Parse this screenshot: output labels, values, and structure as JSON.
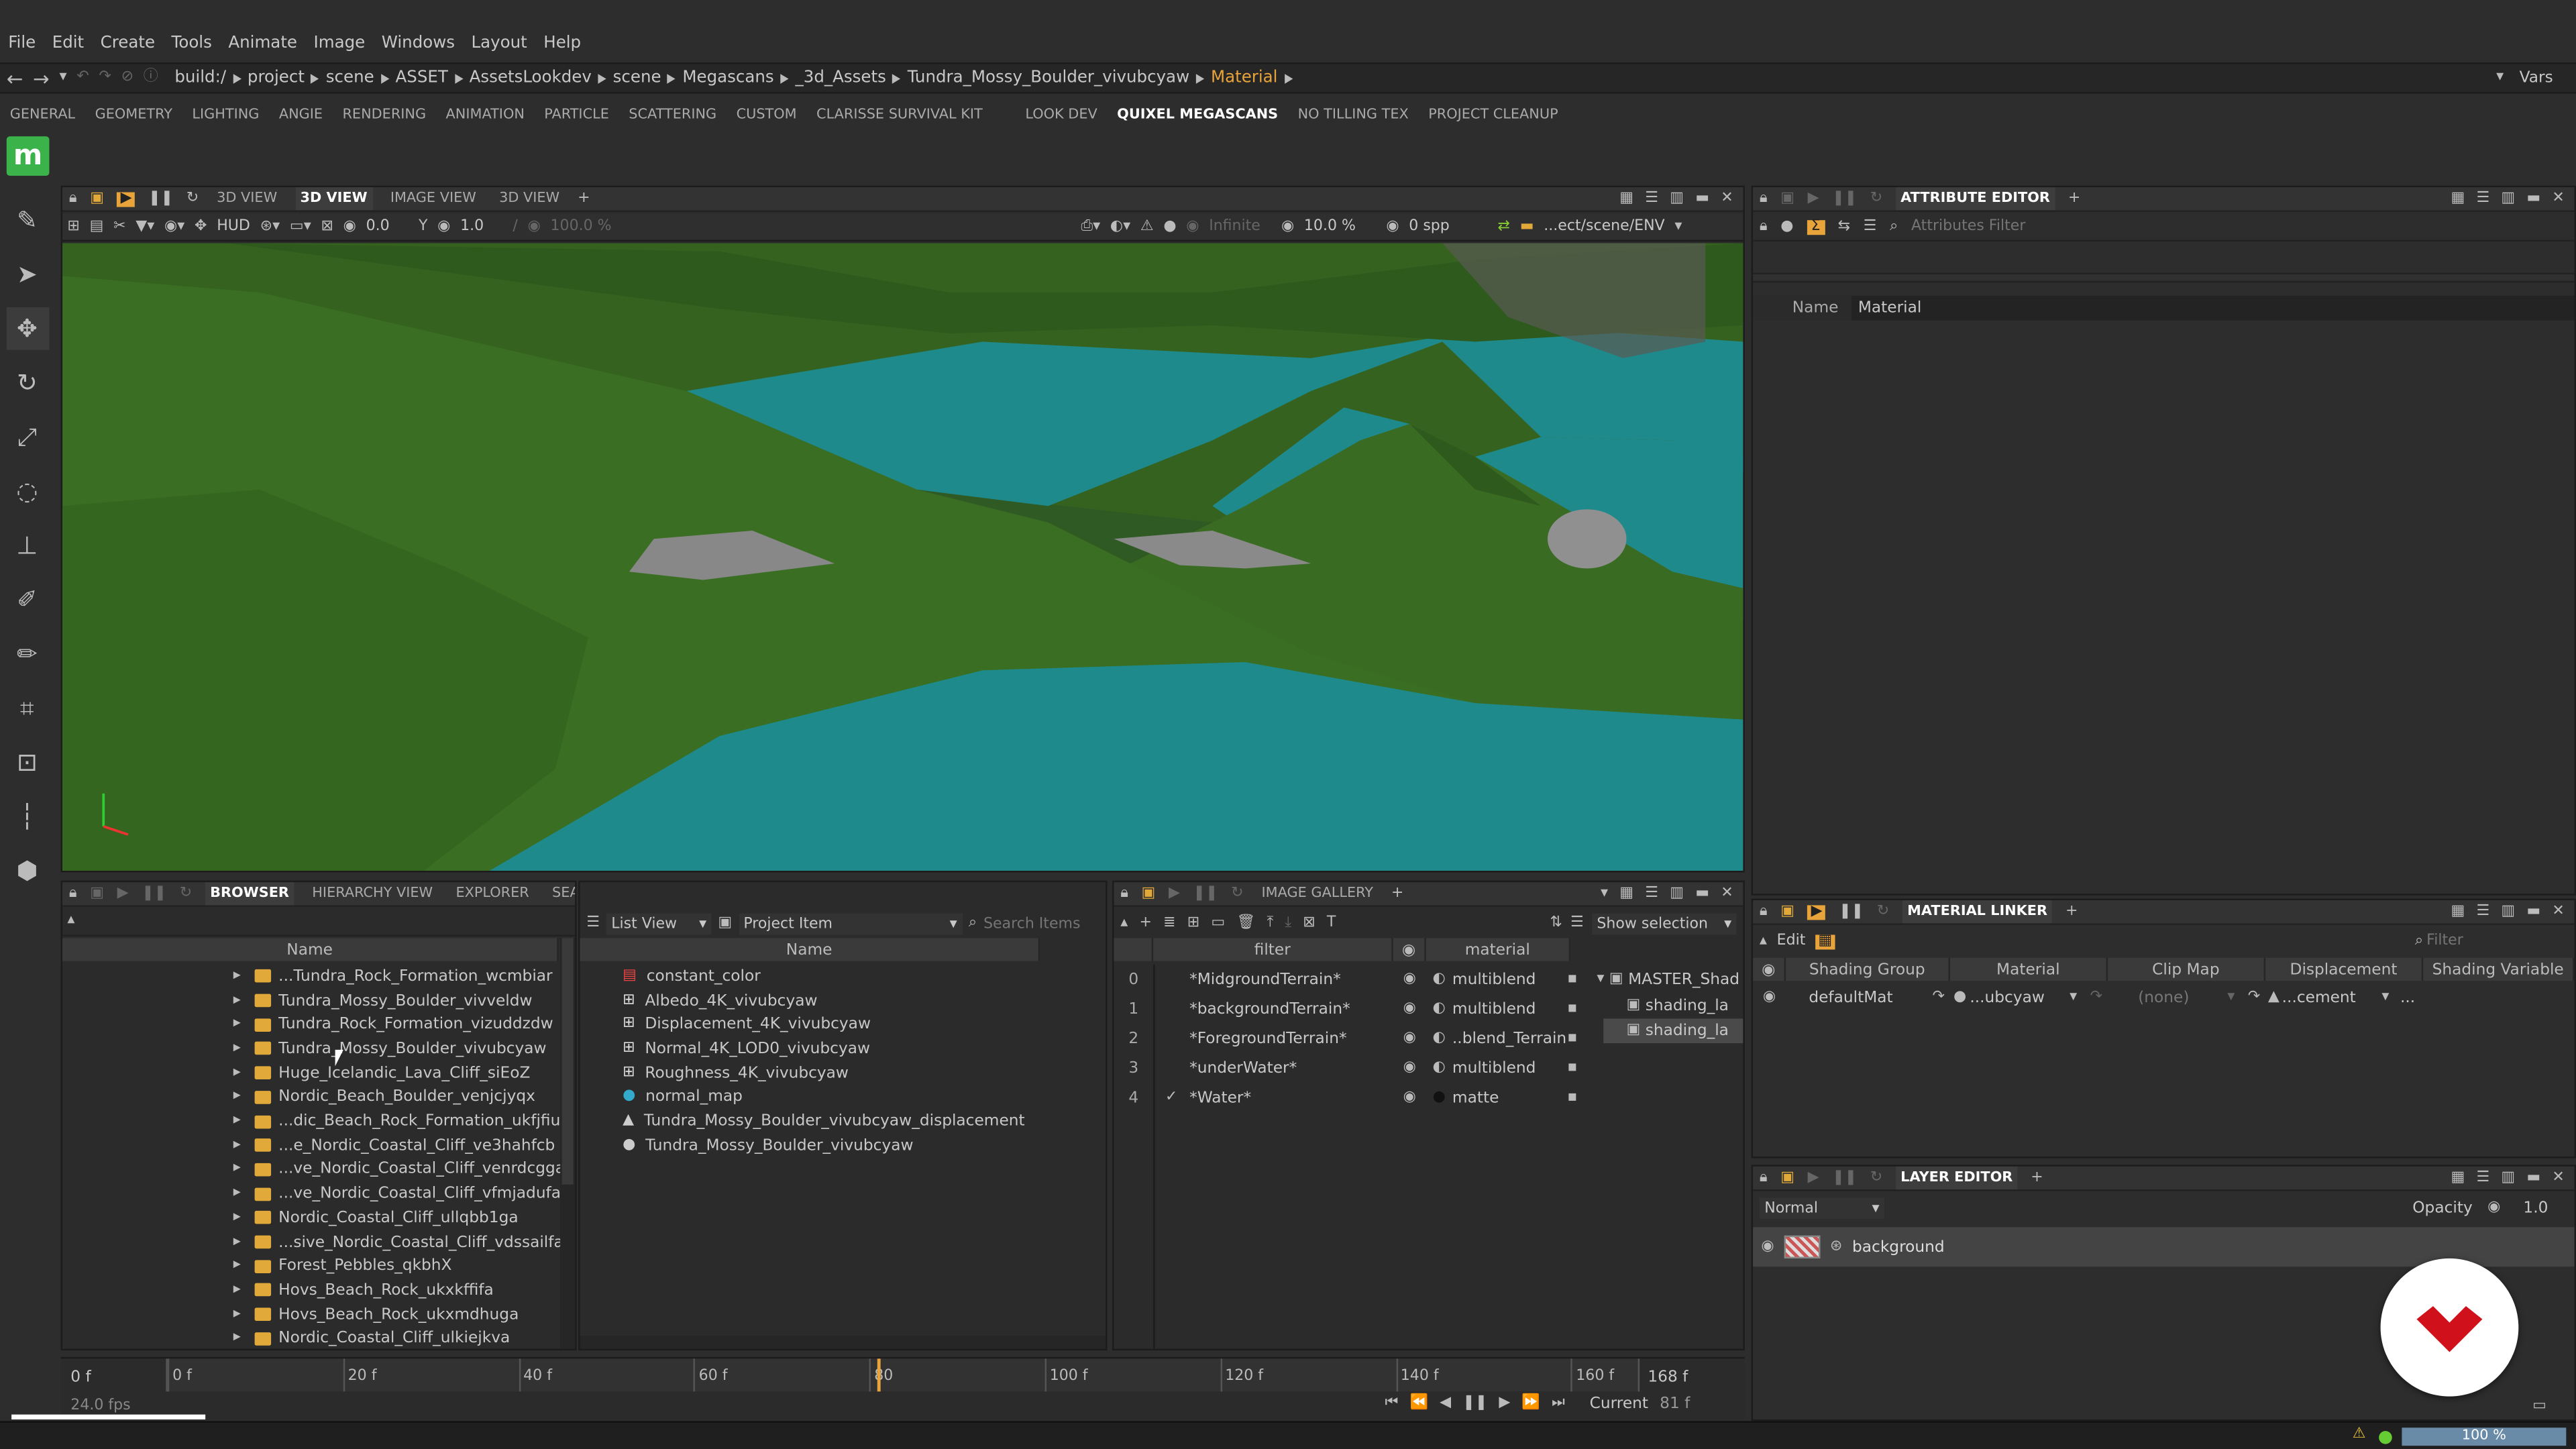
{
  "menu": [
    "File",
    "Edit",
    "Create",
    "Tools",
    "Animate",
    "Image",
    "Windows",
    "Layout",
    "Help"
  ],
  "breadcrumb": [
    "build:/",
    "project",
    "scene",
    "ASSET",
    "AssetsLookdev",
    "scene",
    "Megascans",
    "_3d_Assets",
    "Tundra_Mossy_Boulder_vivubcyaw",
    "Material"
  ],
  "breadcrumb_active_color": "#e8a33a",
  "vars_label": "Vars",
  "shelf_tabs": [
    "GENERAL",
    "GEOMETRY",
    "LIGHTING",
    "ANGIE",
    "RENDERING",
    "ANIMATION",
    "PARTICLE",
    "SCATTERING",
    "CUSTOM",
    "CLARISSE SURVIVAL KIT",
    "LOOK DEV",
    "QUIXEL MEGASCANS",
    "NO TILLING TEX",
    "PROJECT CLEANUP"
  ],
  "shelf_active": "QUIXEL MEGASCANS",
  "viewport": {
    "tabs": [
      "3D VIEW",
      "3D VIEW",
      "IMAGE VIEW",
      "3D VIEW"
    ],
    "active": 1,
    "toolbar": {
      "val1": "0.0",
      "val2": "1.0",
      "zoom": "100.0 %",
      "hud": "HUD",
      "infinite": "Infinite",
      "sampling": "10.0 %",
      "spp": "0 spp",
      "path": "...ect/scene/ENV"
    }
  },
  "attribute_editor": {
    "title": "ATTRIBUTE EDITOR",
    "filter_placeholder": "Attributes Filter",
    "name_label": "Name",
    "name_value": "Material"
  },
  "browser": {
    "tabs": [
      "BROWSER",
      "HIERARCHY VIEW",
      "EXPLORER",
      "SEARCH"
    ],
    "active": "BROWSER",
    "column": "Name",
    "items": [
      "...Tundra_Rock_Formation_wcmbiar",
      "Tundra_Mossy_Boulder_vivveldw",
      "Tundra_Rock_Formation_vizuddzdw",
      "Tundra_Mossy_Boulder_vivubcyaw",
      "Huge_Icelandic_Lava_Cliff_siEoZ",
      "Nordic_Beach_Boulder_venjcjyqx",
      "...dic_Beach_Rock_Formation_ukfjfiu",
      "...e_Nordic_Coastal_Cliff_ve3hahfcb",
      "...ve_Nordic_Coastal_Cliff_venrdcgga",
      "...ve_Nordic_Coastal_Cliff_vfmjadufa",
      "Nordic_Coastal_Cliff_ullqbb1ga",
      "...sive_Nordic_Coastal_Cliff_vdssailfa",
      "Forest_Pebbles_qkbhX",
      "Hovs_Beach_Rock_ukxkffifa",
      "Hovs_Beach_Rock_ukxmdhuga",
      "Nordic_Coastal_Cliff_ulkiejkva"
    ]
  },
  "items_panel": {
    "view": "List View",
    "filter": "Project Item",
    "search_placeholder": "Search Items",
    "column": "Name",
    "items": [
      {
        "label": "constant_color",
        "icon": "color-icon"
      },
      {
        "label": "Albedo_4K_vivubcyaw",
        "icon": "texture-icon"
      },
      {
        "label": "Displacement_4K_vivubcyaw",
        "icon": "texture-icon"
      },
      {
        "label": "Normal_4K_LOD0_vivubcyaw",
        "icon": "texture-icon"
      },
      {
        "label": "Roughness_4K_vivubcyaw",
        "icon": "texture-icon"
      },
      {
        "label": "normal_map",
        "icon": "sphere-icon"
      },
      {
        "label": "Tundra_Mossy_Boulder_vivubcyaw_displacement",
        "icon": "displacement-icon"
      },
      {
        "label": "Tundra_Mossy_Boulder_vivubcyaw",
        "icon": "material-icon"
      }
    ]
  },
  "gallery": {
    "title": "IMAGE GALLERY",
    "show_selection": "Show selection",
    "col_filter": "filter",
    "col_material": "material",
    "rows": [
      {
        "idx": "0",
        "filter": "*MidgroundTerrain*",
        "material": "multiblend"
      },
      {
        "idx": "1",
        "filter": "*backgroundTerrain*",
        "material": "multiblend"
      },
      {
        "idx": "2",
        "filter": "*ForegroundTerrain*",
        "material": "..blend_Terrain"
      },
      {
        "idx": "3",
        "filter": "*underWater*",
        "material": "multiblend"
      },
      {
        "idx": "4",
        "filter": "*Water*",
        "material": "matte"
      }
    ],
    "tree": [
      "MASTER_Shad",
      "shading_la",
      "shading_la"
    ]
  },
  "material_linker": {
    "title": "MATERIAL LINKER",
    "edit": "Edit",
    "filter_placeholder": "Filter",
    "columns": [
      "Shading Group",
      "Material",
      "Clip Map",
      "Displacement",
      "Shading Variable"
    ],
    "row": {
      "group": "defaultMat",
      "material": "...ubcyaw",
      "clip": "(none)",
      "disp": "...cement",
      "var": "..."
    }
  },
  "layer_editor": {
    "title": "LAYER EDITOR",
    "mode": "Normal",
    "opacity_label": "Opacity",
    "opacity_value": "1.0",
    "layer": "background"
  },
  "timeline": {
    "start": "0 f",
    "fps": "24.0 fps",
    "ticks": [
      "0 f",
      "20 f",
      "40 f",
      "60 f",
      "80",
      "100 f",
      "120 f",
      "140 f",
      "160 f"
    ],
    "end": "168 f",
    "current_label": "Current",
    "current_value": "81 f",
    "playhead_frame": 81,
    "range_end": 168
  },
  "status": {
    "zoom": "100 %"
  },
  "add_tab": "+",
  "app_logo": "m"
}
